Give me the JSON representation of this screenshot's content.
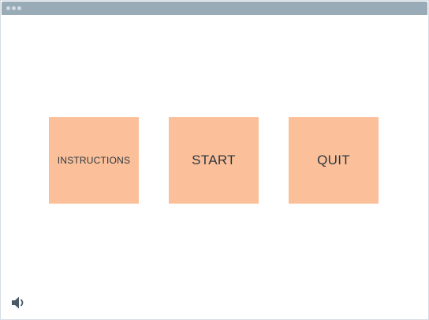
{
  "menu": {
    "instructions_label": "INSTRUCTIONS",
    "start_label": "START",
    "quit_label": "QUIT"
  },
  "icons": {
    "sound": "speaker-icon"
  },
  "colors": {
    "titlebar": "#9aabb8",
    "button_bg": "#fbc09a",
    "button_text": "#2d3640",
    "icon": "#4a5966"
  }
}
